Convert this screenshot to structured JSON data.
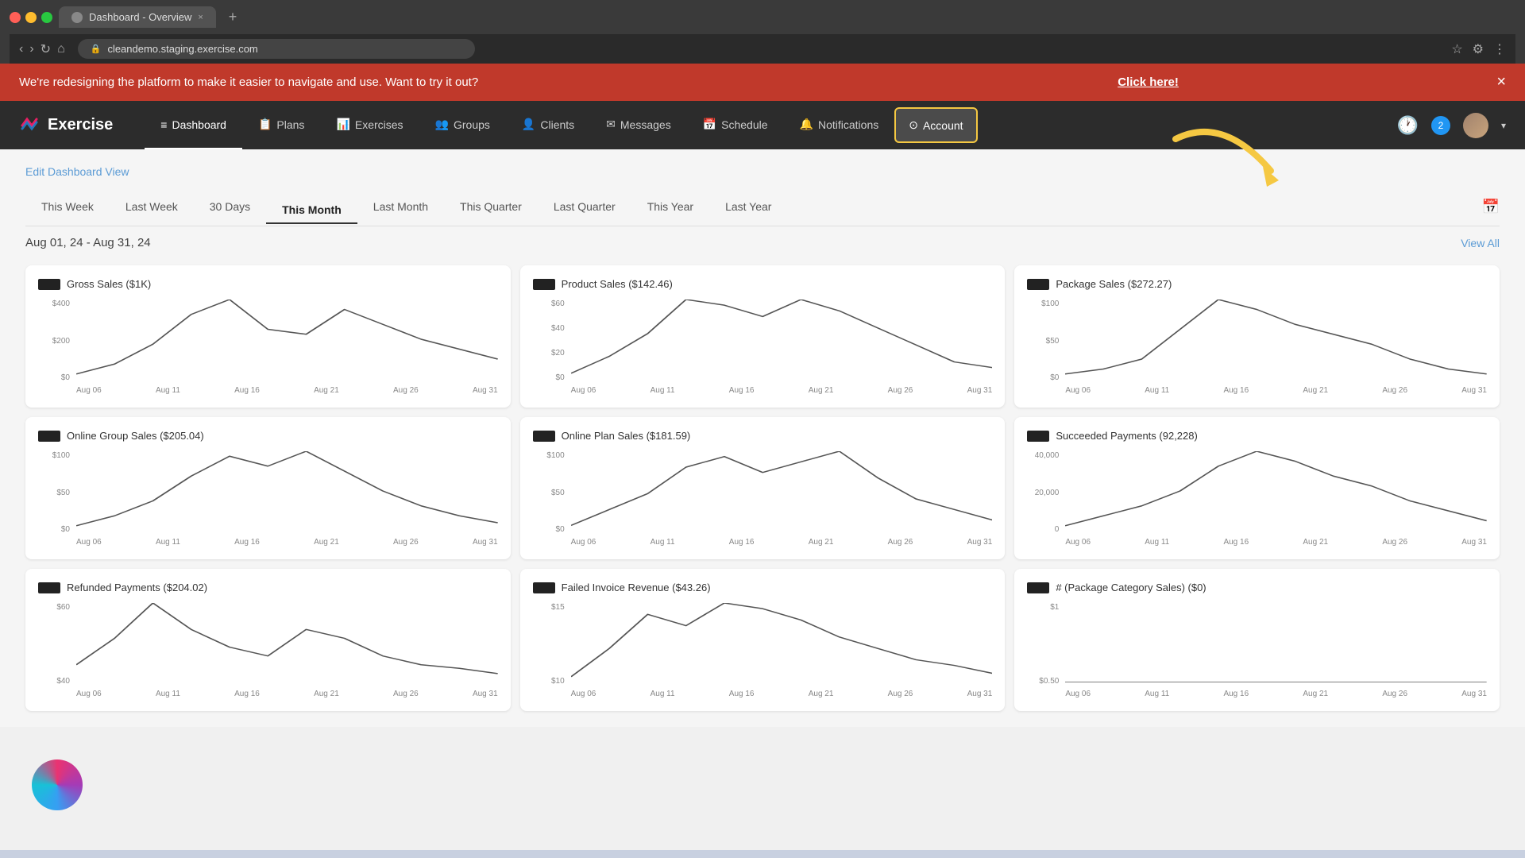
{
  "browser": {
    "tab_title": "Dashboard - Overview",
    "url": "cleandemo.staging.exercise.com",
    "new_tab_label": "+"
  },
  "banner": {
    "message": "We're redesigning the platform to make it easier to navigate and use. Want to try it out?",
    "link_text": "Click here!",
    "close_label": "×"
  },
  "nav": {
    "logo_text": "Exercise",
    "items": [
      {
        "label": "Dashboard",
        "active": true
      },
      {
        "label": "Plans"
      },
      {
        "label": "Exercises"
      },
      {
        "label": "Groups"
      },
      {
        "label": "Clients"
      },
      {
        "label": "Messages"
      },
      {
        "label": "Schedule"
      },
      {
        "label": "Notifications"
      },
      {
        "label": "Account",
        "account": true
      }
    ],
    "notification_count": "2"
  },
  "content": {
    "edit_link": "Edit Dashboard View",
    "period_tabs": [
      {
        "label": "This Week"
      },
      {
        "label": "Last Week"
      },
      {
        "label": "30 Days"
      },
      {
        "label": "This Month",
        "active": true
      },
      {
        "label": "Last Month"
      },
      {
        "label": "This Quarter"
      },
      {
        "label": "Last Quarter"
      },
      {
        "label": "This Year"
      },
      {
        "label": "Last Year"
      }
    ],
    "date_range": "Aug 01, 24 - Aug 31, 24",
    "view_all": "View All",
    "charts": [
      {
        "title": "Gross Sales ($1K)",
        "y_labels": [
          "$400",
          "$200",
          "$0"
        ],
        "x_labels": [
          "Aug 06",
          "Aug 11",
          "Aug 16",
          "Aug 21",
          "Aug 26",
          "Aug 31"
        ],
        "data": [
          5,
          15,
          35,
          65,
          80,
          50,
          45,
          70,
          55,
          40,
          30,
          20
        ]
      },
      {
        "title": "Product Sales ($142.46)",
        "y_labels": [
          "$60",
          "$40",
          "$20",
          "$0"
        ],
        "x_labels": [
          "Aug 06",
          "Aug 11",
          "Aug 16",
          "Aug 21",
          "Aug 26",
          "Aug 31"
        ],
        "data": [
          5,
          20,
          40,
          70,
          65,
          55,
          70,
          60,
          45,
          30,
          15,
          10
        ]
      },
      {
        "title": "Package Sales ($272.27)",
        "y_labels": [
          "$100",
          "$50",
          "$0"
        ],
        "x_labels": [
          "Aug 06",
          "Aug 11",
          "Aug 16",
          "Aug 21",
          "Aug 26",
          "Aug 31"
        ],
        "data": [
          5,
          10,
          20,
          50,
          80,
          70,
          55,
          45,
          35,
          20,
          10,
          5
        ]
      },
      {
        "title": "Online Group Sales ($205.04)",
        "y_labels": [
          "$100",
          "$50",
          "$0"
        ],
        "x_labels": [
          "Aug 06",
          "Aug 11",
          "Aug 16",
          "Aug 21",
          "Aug 26",
          "Aug 31"
        ],
        "data": [
          5,
          15,
          30,
          55,
          75,
          65,
          80,
          60,
          40,
          25,
          15,
          8
        ]
      },
      {
        "title": "Online Plan Sales ($181.59)",
        "y_labels": [
          "$100",
          "$50",
          "$0"
        ],
        "x_labels": [
          "Aug 06",
          "Aug 11",
          "Aug 16",
          "Aug 21",
          "Aug 26",
          "Aug 31"
        ],
        "data": [
          5,
          20,
          35,
          60,
          70,
          55,
          65,
          75,
          50,
          30,
          20,
          10
        ]
      },
      {
        "title": "Succeeded Payments (92,228)",
        "y_labels": [
          "40,000",
          "20,000",
          "0"
        ],
        "x_labels": [
          "Aug 06",
          "Aug 11",
          "Aug 16",
          "Aug 21",
          "Aug 26",
          "Aug 31"
        ],
        "data": [
          5,
          15,
          25,
          40,
          65,
          80,
          70,
          55,
          45,
          30,
          20,
          10
        ]
      },
      {
        "title": "Refunded Payments ($204.02)",
        "y_labels": [
          "$60",
          "$40"
        ],
        "x_labels": [
          "Aug 06",
          "Aug 11",
          "Aug 16",
          "Aug 21",
          "Aug 26",
          "Aug 31"
        ],
        "data": [
          10,
          25,
          45,
          30,
          20,
          15,
          30,
          25,
          15,
          10,
          8,
          5
        ]
      },
      {
        "title": "Failed Invoice Revenue ($43.26)",
        "y_labels": [
          "$15",
          "$10"
        ],
        "x_labels": [
          "Aug 06",
          "Aug 11",
          "Aug 16",
          "Aug 21",
          "Aug 26",
          "Aug 31"
        ],
        "data": [
          5,
          30,
          60,
          50,
          70,
          65,
          55,
          40,
          30,
          20,
          15,
          8
        ]
      },
      {
        "title": "# (Package Category Sales) ($0)",
        "y_labels": [
          "$1",
          "$0.50"
        ],
        "x_labels": [
          "Aug 06",
          "Aug 11",
          "Aug 16",
          "Aug 21",
          "Aug 26",
          "Aug 31"
        ],
        "data": [
          0,
          0,
          0,
          0,
          0,
          0,
          0,
          0,
          0,
          0,
          0,
          0
        ]
      }
    ]
  },
  "colors": {
    "accent_red": "#c0392b",
    "accent_yellow": "#f5c842",
    "accent_blue": "#5b9bd5",
    "nav_bg": "#2c2c2c",
    "chart_line": "#666"
  }
}
